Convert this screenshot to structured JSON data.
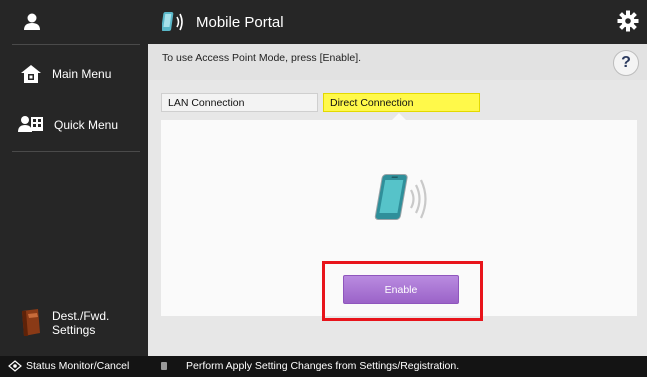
{
  "topbar": {
    "title": "Mobile Portal",
    "icon": "mobile-phone-icon",
    "settings_icon": "gear-icon"
  },
  "sidebar": {
    "user_icon": "user-icon",
    "items": [
      {
        "label": "Main Menu",
        "icon": "home-icon"
      },
      {
        "label": "Quick Menu",
        "icon": "quick-menu-icon"
      },
      {
        "label_line1": "Dest./Fwd.",
        "label_line2": "Settings",
        "icon": "address-book-icon"
      }
    ]
  },
  "content": {
    "message": "To use Access Point Mode, press [Enable].",
    "help_label": "?",
    "tabs": [
      {
        "label": "LAN Connection",
        "selected": false
      },
      {
        "label": "Direct Connection",
        "selected": true
      }
    ],
    "enable_button": "Enable"
  },
  "statusbar": {
    "left_label": "Status Monitor/Cancel",
    "message": "Perform Apply Setting Changes from Settings/Registration."
  },
  "colors": {
    "selected_tab": "#fff94a",
    "enable_button": "#a770d2",
    "highlight": "#e8141b"
  }
}
